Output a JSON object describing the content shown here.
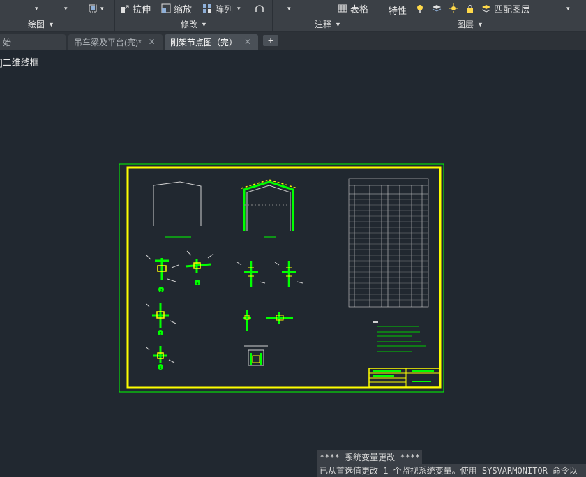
{
  "ribbon": {
    "buttons": {
      "stretch": "拉伸",
      "scale": "缩放",
      "array": "阵列",
      "table": "表格",
      "properties": "特性",
      "match_layer": "匹配图层"
    },
    "panels": {
      "draw": "绘图",
      "modify": "修改",
      "annotation": "注释",
      "layers": "图层"
    }
  },
  "tabs": [
    {
      "label": "始",
      "closable": false,
      "active": false
    },
    {
      "label": "吊车梁及平台(完)*",
      "closable": true,
      "active": false
    },
    {
      "label": "刚架节点图（完）",
      "closable": true,
      "active": true
    }
  ],
  "tab_add_label": "+",
  "viewport": {
    "label": "]二维线框"
  },
  "command_line": {
    "line1": "**** 系统变量更改 ****",
    "line2": "已从首选值更改 1 个监视系统变量。使用 SYSVARMONITOR 命令以"
  },
  "drawing": {
    "detail_numbers": [
      "3",
      "4",
      "2",
      "1"
    ]
  },
  "colors": {
    "background": "#212830",
    "border_green": "#00ff00",
    "frame_yellow": "#ffff00"
  }
}
